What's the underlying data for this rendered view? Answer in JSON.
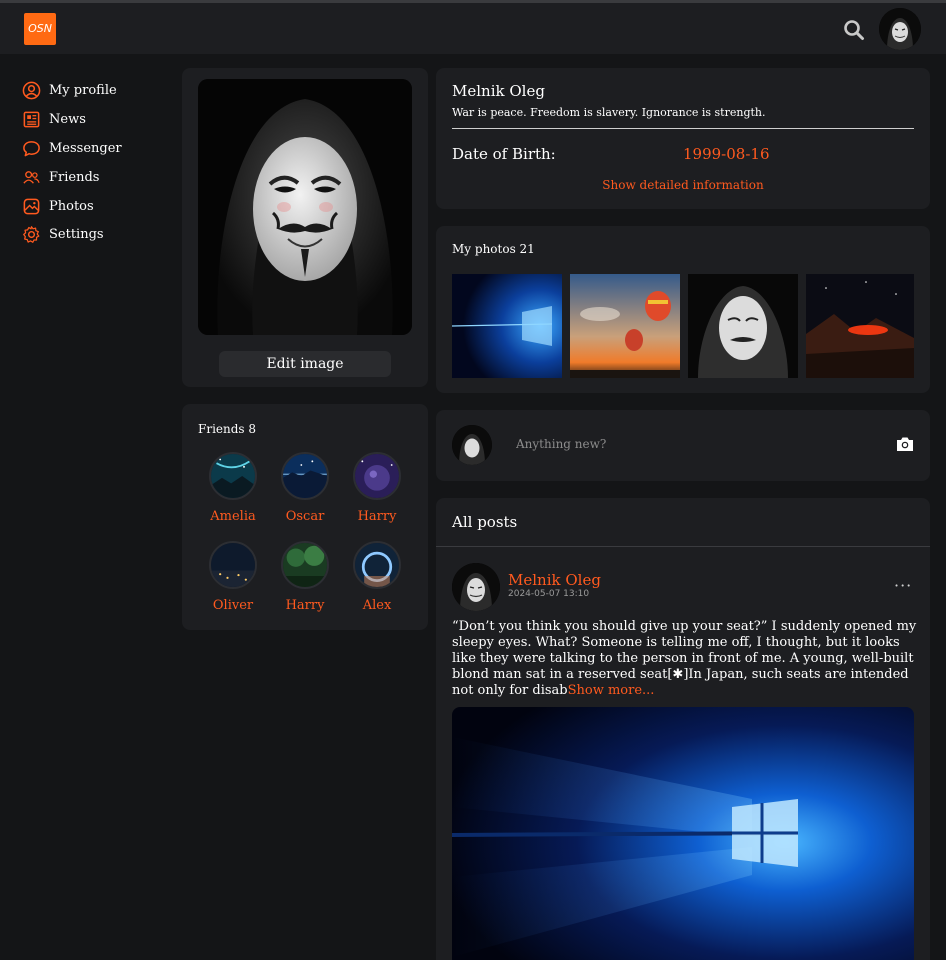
{
  "header": {
    "logo_text": "OSN",
    "accent_color": "#ff5a1f",
    "search_icon": "search-icon",
    "avatar_icon": "avatar"
  },
  "sidebar": {
    "items": [
      {
        "label": "My profile",
        "icon": "user-circle-icon"
      },
      {
        "label": "News",
        "icon": "newspaper-icon"
      },
      {
        "label": "Messenger",
        "icon": "chat-bubble-icon"
      },
      {
        "label": "Friends",
        "icon": "friends-icon"
      },
      {
        "label": "Photos",
        "icon": "image-icon"
      },
      {
        "label": "Settings",
        "icon": "gear-icon"
      }
    ]
  },
  "profile": {
    "edit_image_label": "Edit image"
  },
  "friends": {
    "title": "Friends 8",
    "list": [
      {
        "name": "Amelia"
      },
      {
        "name": "Oscar"
      },
      {
        "name": "Harry"
      },
      {
        "name": "Oliver"
      },
      {
        "name": "Harry"
      },
      {
        "name": "Alex"
      }
    ]
  },
  "info": {
    "name": "Melnik Oleg",
    "status": "War is peace. Freedom is slavery. Ignorance is strength.",
    "dob_label": "Date of Birth:",
    "dob_value": "1999-08-16",
    "show_detailed": "Show detailed information"
  },
  "photos": {
    "title": "My photos 21"
  },
  "composer": {
    "placeholder": "Anything new?",
    "camera_icon": "camera-icon"
  },
  "posts": {
    "title": "All posts",
    "items": [
      {
        "author": "Melnik Oleg",
        "date": "2024-05-07 13:10",
        "text": "“Don’t you think you should give up your seat?” I suddenly opened my sleepy eyes. What? Someone is telling me off, I thought, but it looks like they were talking to the person in front of me. A young, well-built blond man sat in a reserved seat[✱]In Japan, such seats are intended not only for disab",
        "show_more": "Show more...",
        "menu": "···"
      }
    ]
  }
}
